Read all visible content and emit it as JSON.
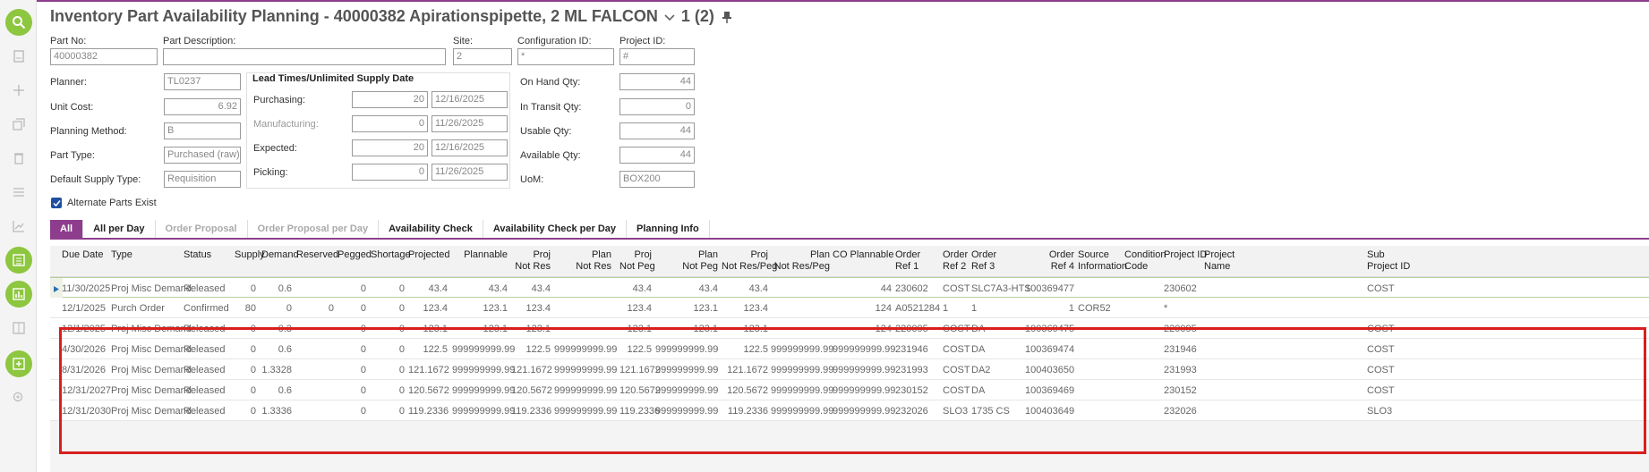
{
  "title": {
    "text": "Inventory Part Availability Planning - 40000382 Apirationspipette, 2 ML  FALCON",
    "counter": "1 (2)"
  },
  "header": {
    "part_no_label": "Part No:",
    "part_no": "40000382",
    "part_desc_label": "Part Description:",
    "part_desc": "",
    "site_label": "Site:",
    "site": "2",
    "config_label": "Configuration ID:",
    "config": "*",
    "project_label": "Project ID:",
    "project": "#",
    "planner_label": "Planner:",
    "planner": "TL0237",
    "unit_cost_label": "Unit Cost:",
    "unit_cost": "6.92",
    "planning_method_label": "Planning Method:",
    "planning_method": "B",
    "part_type_label": "Part Type:",
    "part_type": "Purchased (raw)",
    "default_supply_label": "Default Supply Type:",
    "default_supply": "Requisition",
    "lead_title": "Lead Times/Unlimited Supply Date",
    "purchasing_label": "Purchasing:",
    "purchasing_days": "20",
    "purchasing_date": "12/16/2025",
    "manufacturing_label": "Manufacturing:",
    "manufacturing_days": "0",
    "manufacturing_date": "11/26/2025",
    "expected_label": "Expected:",
    "expected_days": "20",
    "expected_date": "12/16/2025",
    "picking_label": "Picking:",
    "picking_days": "0",
    "picking_date": "11/26/2025",
    "on_hand_label": "On Hand Qty:",
    "on_hand": "44",
    "in_transit_label": "In Transit Qty:",
    "in_transit": "0",
    "usable_label": "Usable Qty:",
    "usable": "44",
    "available_label": "Available Qty:",
    "available": "44",
    "uom_label": "UoM:",
    "uom": "BOX200",
    "alt_parts_label": "Alternate Parts Exist"
  },
  "tabs": [
    "All",
    "All per Day",
    "Order Proposal",
    "Order Proposal per Day",
    "Availability Check",
    "Availability Check per Day",
    "Planning Info"
  ],
  "columns": [
    "Due Date",
    "Type",
    "Status",
    "Supply",
    "Demand",
    "Reserved",
    "Pegged",
    "Shortage",
    "Projected",
    "Plannable",
    "Proj\nNot Res",
    "Plan\nNot Res",
    "Proj\nNot Peg",
    "Plan\nNot Peg",
    "Proj\nNot Res/Peg",
    "Plan\nNot Res/Peg",
    "CO Plannable",
    "Order\nRef 1",
    "Order\nRef 2",
    "Order\nRef 3",
    "Order\nRef 4",
    "Source\nInformation",
    "Condition\nCode",
    "Project ID",
    "Project\nName",
    "Sub\nProject ID"
  ],
  "rows": [
    [
      "11/30/2025",
      "Proj Misc Demand",
      "Released",
      "0",
      "0.6",
      "",
      "0",
      "0",
      "43.4",
      "43.4",
      "43.4",
      "",
      "43.4",
      "43.4",
      "43.4",
      "",
      "44",
      "230602",
      "COST",
      "SLC7A3-HTS",
      "100369477",
      "",
      "",
      "230602",
      "",
      "COST"
    ],
    [
      "12/1/2025",
      "Purch Order",
      "Confirmed",
      "80",
      "0",
      "0",
      "0",
      "0",
      "123.4",
      "123.1",
      "123.4",
      "",
      "123.4",
      "123.1",
      "123.4",
      "",
      "124",
      "A0521284",
      "1",
      "1",
      "1",
      "COR52",
      "",
      "*",
      "",
      ""
    ],
    [
      "12/1/2025",
      "Proj Misc Demand",
      "Released",
      "0",
      "0.3",
      "",
      "0",
      "0",
      "123.1",
      "123.1",
      "123.1",
      "",
      "123.1",
      "123.1",
      "123.1",
      "",
      "124",
      "220095",
      "COST",
      "DA",
      "100369475",
      "",
      "",
      "220095",
      "",
      "COST"
    ],
    [
      "4/30/2026",
      "Proj Misc Demand",
      "Released",
      "0",
      "0.6",
      "",
      "0",
      "0",
      "122.5",
      "999999999.99",
      "122.5",
      "999999999.99",
      "122.5",
      "999999999.99",
      "122.5",
      "999999999.99",
      "999999999.99",
      "231946",
      "COST",
      "DA",
      "100369474",
      "",
      "",
      "231946",
      "",
      "COST"
    ],
    [
      "8/31/2026",
      "Proj Misc Demand",
      "Released",
      "0",
      "1.3328",
      "",
      "0",
      "0",
      "121.1672",
      "999999999.99",
      "121.1672",
      "999999999.99",
      "121.1672",
      "999999999.99",
      "121.1672",
      "999999999.99",
      "999999999.99",
      "231993",
      "COST",
      "DA2",
      "100403650",
      "",
      "",
      "231993",
      "",
      "COST"
    ],
    [
      "12/31/2027",
      "Proj Misc Demand",
      "Released",
      "0",
      "0.6",
      "",
      "0",
      "0",
      "120.5672",
      "999999999.99",
      "120.5672",
      "999999999.99",
      "120.5672",
      "999999999.99",
      "120.5672",
      "999999999.99",
      "999999999.99",
      "230152",
      "COST",
      "DA",
      "100369469",
      "",
      "",
      "230152",
      "",
      "COST"
    ],
    [
      "12/31/2030",
      "Proj Misc Demand",
      "Released",
      "0",
      "1.3336",
      "",
      "0",
      "0",
      "119.2336",
      "999999999.99",
      "119.2336",
      "999999999.99",
      "119.2336",
      "999999999.99",
      "119.2336",
      "999999999.99",
      "999999999.99",
      "232026",
      "SLO3",
      "1735 CS",
      "100403649",
      "",
      "",
      "232026",
      "",
      "SLO3"
    ]
  ],
  "colors": {
    "accent": "#8e3d8e",
    "rail_button": "#8dc63f",
    "highlight": "#d91e1e"
  },
  "rail_icons": [
    "search-icon",
    "document-icon",
    "add-icon",
    "duplicate-icon",
    "delete-icon",
    "list-icon",
    "chart-icon",
    "list-view-icon",
    "chart-view-icon",
    "split-view-icon",
    "edit-icon",
    "zoom-icon"
  ]
}
